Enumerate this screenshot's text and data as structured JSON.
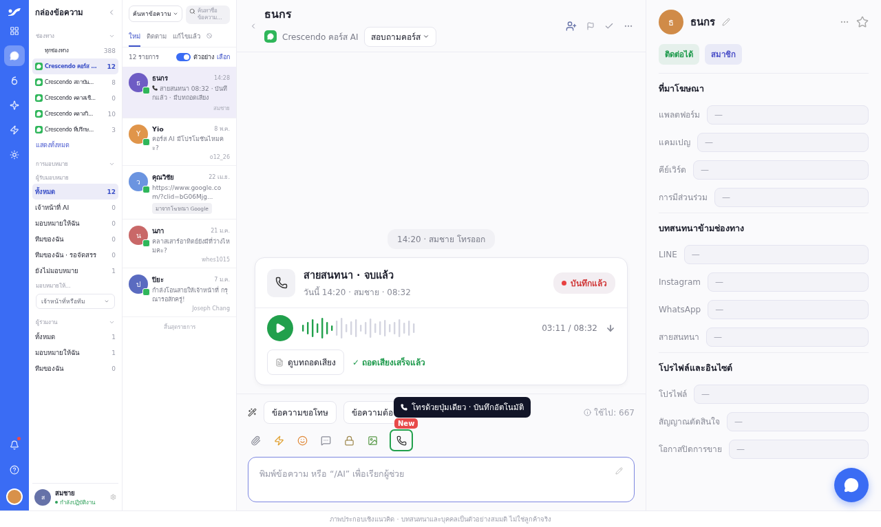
{
  "rail": {
    "items": [
      {
        "kind": "grid",
        "selected": false
      },
      {
        "kind": "chat",
        "selected": true
      },
      {
        "kind": "contacts",
        "selected": false
      },
      {
        "kind": "sparkle",
        "selected": false
      },
      {
        "kind": "bolt",
        "selected": false
      },
      {
        "kind": "settings",
        "selected": false
      }
    ],
    "notifications": {
      "unread": true
    }
  },
  "inbox": {
    "title": "กล่องข้อความ",
    "channels": {
      "heading": "ช่องทาง",
      "show_all": "แสดงทั้งหมด",
      "items": [
        {
          "kind": "all",
          "label": "ทุกช่องทาง",
          "count": "388",
          "selected": false
        },
        {
          "kind": "line",
          "label": "Crescendo คอร์ส ...",
          "count": "12",
          "selected": true
        },
        {
          "kind": "line",
          "label": "Crescendo สถาบัน...",
          "count": "8",
          "selected": false
        },
        {
          "kind": "line",
          "label": "Crescendo คลาสเชี...",
          "count": "0",
          "selected": false
        },
        {
          "kind": "line",
          "label": "Crescendo คลาสวิ...",
          "count": "10",
          "selected": false
        },
        {
          "kind": "line",
          "label": "Crescendo ที่ปรึกษ...",
          "count": "3",
          "selected": false
        }
      ]
    },
    "assignment": {
      "heading": "การมอบหมาย",
      "subheading": "ผู้รับมอบหมาย",
      "items": [
        {
          "label": "ทั้งหมด",
          "count": "12",
          "selected": true
        },
        {
          "label": "เจ้าหน้าที่ AI",
          "count": "0",
          "selected": false
        },
        {
          "label": "มอบหมายให้ฉัน",
          "count": "0",
          "selected": false
        },
        {
          "label": "ทีมของฉัน",
          "count": "0",
          "selected": false
        },
        {
          "label": "ทีมของฉัน · รอจัดสรร",
          "count": "0",
          "selected": false
        },
        {
          "label": "ยังไม่มอบหมาย",
          "count": "1",
          "selected": false
        }
      ],
      "assign_label": "มอบหมายให้...",
      "assign_select": "เจ้าหน้าที่หรือทีม"
    },
    "collaborators": {
      "heading": "ผู้ร่วมงาน",
      "items": [
        {
          "label": "ทั้งหมด",
          "count": "1",
          "selected": false
        },
        {
          "label": "มอบหมายให้ฉัน",
          "count": "1",
          "selected": false
        },
        {
          "label": "ทีมของฉัน",
          "count": "0",
          "selected": false
        }
      ]
    },
    "user": {
      "initial": "ส",
      "name": "สมชาย",
      "status": "กำลังปฏิบัติงาน"
    }
  },
  "list": {
    "search_scope": "ค้นหาข้อความ",
    "search_placeholder": "ค้นหาชื่อ ข้อความ...",
    "tabs": [
      {
        "label": "ใหม่",
        "selected": true
      },
      {
        "label": "ติดตาม",
        "selected": false
      },
      {
        "label": "แก้ไขแล้ว",
        "selected": false
      }
    ],
    "count": "12 รายการ",
    "preview_on": true,
    "preview_label": "ตัวอย่าง",
    "select_label": "เลือก",
    "conversations": [
      {
        "initial": "ธ",
        "color": "#6e5cc4",
        "name": "ธนกร",
        "time": "14:28",
        "kind": "call",
        "preview": "สายสนทนา 08:32 · บันทึกแล้ว · มีบทถอดเสียง",
        "agent": "สมชาย",
        "selected": true
      },
      {
        "initial": "Y",
        "color": "#e0954a",
        "name": "Yio",
        "time": "8 พ.ค.",
        "kind": "text",
        "preview": "คอร์ส AI มีโปรโมชันไหมคะ?",
        "agent": "o12_26",
        "selected": false
      },
      {
        "initial": "ว",
        "color": "#6b94e0",
        "name": "คุณวิชัย",
        "time": "22 เม.ย.",
        "kind": "text",
        "preview": "https://www.google.com/?clid=bG06Mjg...",
        "tag": "มาจากโฆษณา Google",
        "selected": false
      },
      {
        "initial": "น",
        "color": "#c96868",
        "name": "นภา",
        "time": "21 ม.ค.",
        "kind": "text",
        "preview": "คลาสเสาร์อาทิตย์ยังมีที่ว่างไหมคะ?",
        "agent": "whes1015",
        "selected": false
      },
      {
        "initial": "ป",
        "color": "#5a6bc0",
        "name": "ปิยะ",
        "time": "7 ม.ค.",
        "kind": "text",
        "preview": "กำลังโอนสายให้เจ้าหน้าที่ กรุณารอสักครู่!",
        "agent": "Joseph Chang",
        "selected": false
      }
    ],
    "end": "สิ้นสุดรายการ"
  },
  "chat": {
    "name": "ธนกร",
    "channel": "Crescendo คอร์ส AI",
    "topic": "สอบถามคอร์ส",
    "event": "14:20 · สมชาย โทรออก",
    "call": {
      "title": "สายสนทนา · จบแล้ว",
      "subtitle": "วันนี้ 14:20 · สมชาย · 08:32",
      "badge": "บันทึกแล้ว",
      "level": 0.3,
      "time": "03:11 / 08:32",
      "transcript_button": "ดูบทถอดเสียง",
      "transcript_status": "✓ ถอดเสียงเสร็จแล้ว"
    },
    "quick_replies": [
      "ข้อความขอโทษ",
      "ข้อความต้อ"
    ],
    "usage": "ใช้ไป: 667",
    "tools": [
      {
        "kind": "clip",
        "highlighted": false
      },
      {
        "kind": "bolt",
        "highlighted": false
      },
      {
        "kind": "emoji",
        "highlighted": false
      },
      {
        "kind": "bubble",
        "highlighted": false
      },
      {
        "kind": "lock",
        "highlighted": false
      },
      {
        "kind": "image",
        "highlighted": false
      },
      {
        "kind": "phone",
        "highlighted": true,
        "badge": "New"
      }
    ],
    "tooltip": "โทรด้วยปุ่มเดียว · บันทึกอัตโนมัติ",
    "placeholder": "พิมพ์ข้อความ หรือ “/AI” เพื่อเรียกผู้ช่วย"
  },
  "contact": {
    "initial": "ธ",
    "name": "ธนกร",
    "tags": [
      {
        "label": "ติดต่อได้",
        "color": "#1e9a4c"
      },
      {
        "label": "สมาชิก",
        "color": "#4b50c8"
      }
    ],
    "sections": [
      {
        "title": "ที่มาโฆษณา",
        "fields": [
          {
            "label": "แพลตฟอร์ม",
            "value": "—"
          },
          {
            "label": "แคมเปญ",
            "value": "—"
          },
          {
            "label": "คีย์เวิร์ด",
            "value": "—"
          },
          {
            "label": "การมีส่วนร่วม",
            "value": "—"
          }
        ]
      },
      {
        "title": "บทสนทนาข้ามช่องทาง",
        "fields": [
          {
            "label": "LINE",
            "value": "—"
          },
          {
            "label": "Instagram",
            "value": "—"
          },
          {
            "label": "WhatsApp",
            "value": "—"
          },
          {
            "label": "สายสนทนา",
            "value": "—"
          }
        ]
      },
      {
        "title": "โปรไฟล์และอินไซต์",
        "fields": [
          {
            "label": "โปรไฟล์",
            "value": "—"
          },
          {
            "label": "สัญญาณตัดสินใจ",
            "value": "—"
          },
          {
            "label": "โอกาสปิดการขาย",
            "value": "—"
          }
        ]
      }
    ]
  },
  "footer": "ภาพประกอบเชิงแนวคิด · บทสนทนาและบุคคลเป็นตัวอย่างสมมติ ไม่ใช่ลูกค้าจริง"
}
